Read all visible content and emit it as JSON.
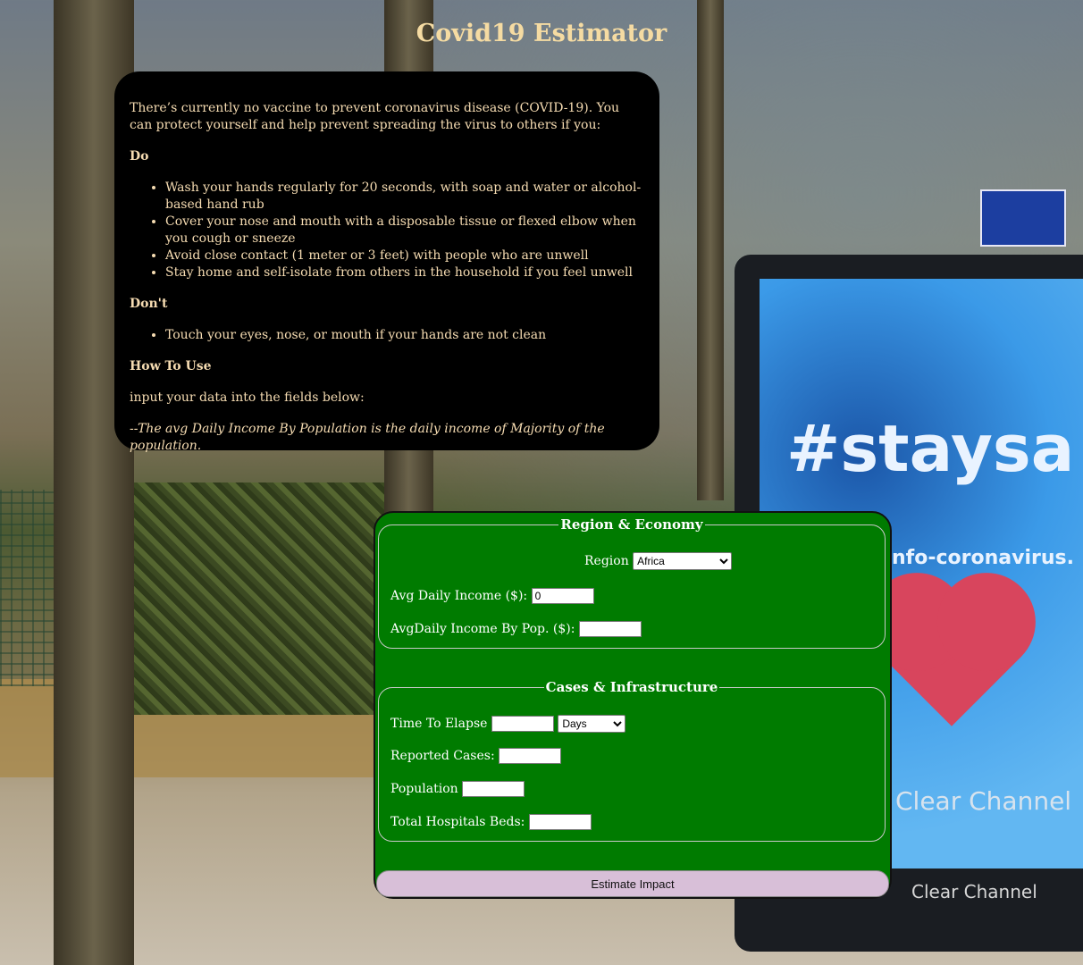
{
  "page": {
    "title": "Covid19 Estimator"
  },
  "info": {
    "intro": "There’s currently no vaccine to prevent coronavirus disease (COVID-19). You can protect yourself and help prevent spreading the virus to others if you:",
    "do_heading": "Do",
    "do_items": [
      "Wash your hands regularly for 20 seconds, with soap and water or alcohol-based hand rub",
      "Cover your nose and mouth with a disposable tissue or flexed elbow when you cough or sneeze",
      "Avoid close contact (1 meter or 3 feet) with people who are unwell",
      "Stay home and self-isolate from others in the household if you feel unwell"
    ],
    "dont_heading": "Don't",
    "dont_items": [
      "Touch your eyes, nose, or mouth if your hands are not clean"
    ],
    "how_heading": "How To Use",
    "how_text": "input your data into the fields below:",
    "note": "--The avg Daily Income By Population is the daily income of Majority of the population."
  },
  "form": {
    "region_economy": {
      "legend": "Region & Economy",
      "region_label": "Region",
      "region_value": "Africa",
      "avg_income_label": "Avg Daily Income ($):",
      "avg_income_value": "0",
      "avg_income_pop_label": "AvgDaily Income By Pop. ($):",
      "avg_income_pop_value": ""
    },
    "cases_infra": {
      "legend": "Cases & Infrastructure",
      "time_label": "Time To Elapse",
      "time_value": "",
      "period_value": "Days",
      "reported_label": "Reported Cases:",
      "reported_value": "",
      "population_label": "Population",
      "population_value": "",
      "beds_label": "Total Hospitals Beds:",
      "beds_value": ""
    },
    "submit_label": "Estimate Impact"
  },
  "background": {
    "billboard_text_1": "#staysa",
    "billboard_text_2": "nfo-coronavirus.",
    "billboard_text_3": "Clear Channel",
    "billboard_text_4": "Clear Channel"
  },
  "colors": {
    "title": "#f5dba2",
    "info_bg": "#000000",
    "form_bg": "#007b00",
    "button_bg": "#d8bfd8"
  }
}
